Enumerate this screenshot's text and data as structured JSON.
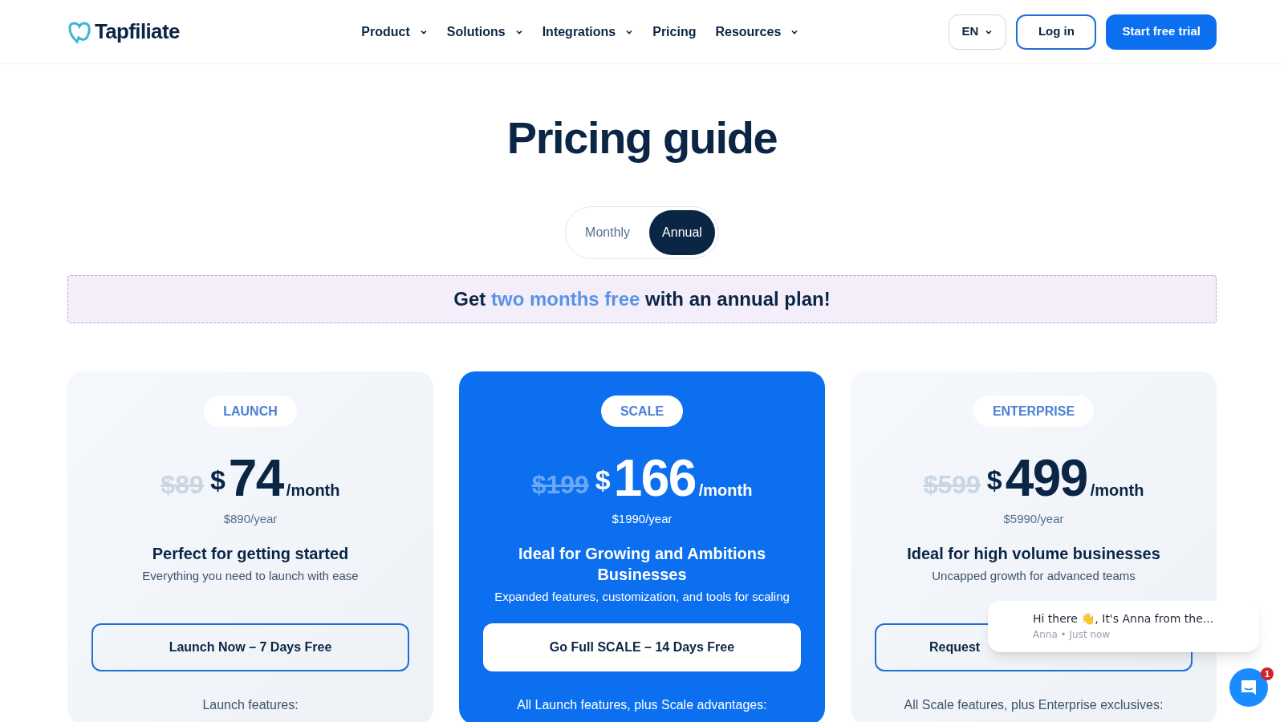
{
  "header": {
    "logo": "Tapfiliate",
    "nav": [
      {
        "label": "Product",
        "dropdown": true
      },
      {
        "label": "Solutions",
        "dropdown": true
      },
      {
        "label": "Integrations",
        "dropdown": true
      },
      {
        "label": "Pricing",
        "dropdown": false
      },
      {
        "label": "Resources",
        "dropdown": true
      }
    ],
    "language": "EN",
    "login": "Log in",
    "cta": "Start free trial"
  },
  "title": "Pricing guide",
  "billing_toggle": [
    {
      "label": "Monthly",
      "selected": false
    },
    {
      "label": "Annual",
      "selected": true
    }
  ],
  "banner": "Get **two months free** with an annual plan!",
  "plans": [
    {
      "name": "LAUNCH",
      "highlighted": false,
      "old_price": "89",
      "currency": "$",
      "price": "74",
      "period": "/month",
      "yearly": "$890/year",
      "tagline": "Perfect for getting started",
      "description": "Everything you need to launch with ease",
      "button": "Launch Now – 7 Days Free",
      "features_intro": "Launch features:"
    },
    {
      "name": "SCALE",
      "highlighted": true,
      "old_price": "199",
      "currency": "$",
      "price": "166",
      "period": "/month",
      "yearly": "$1990/year",
      "tagline": "Ideal for Growing and Ambitions Businesses",
      "description": "Expanded features, customization, and tools for scaling",
      "button": "Go Full SCALE – 14 Days Free",
      "features_intro": "All Launch features, plus Scale advantages:"
    },
    {
      "name": "ENTERPRISE",
      "highlighted": false,
      "old_price": "599",
      "currency": "$",
      "price": "499",
      "period": "/month",
      "yearly": "$5990/year",
      "tagline": "Ideal for high volume businesses",
      "description": "Uncapped growth for advanced teams",
      "button": "Request",
      "button_partly_covered": true,
      "features_intro": "All Scale features, plus Enterprise exclusives:"
    }
  ],
  "chat": {
    "message": "Hi there 👋, It's Anna from the...",
    "byline": "Anna • Just now",
    "unread": "1"
  }
}
